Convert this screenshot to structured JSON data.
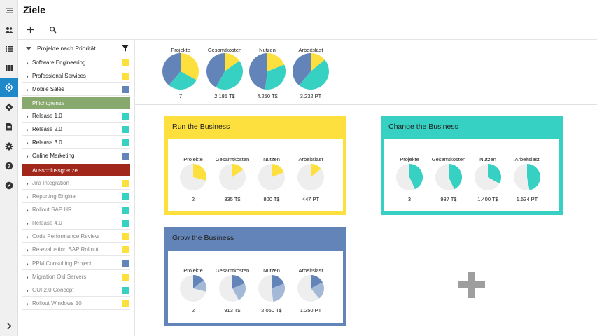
{
  "page": {
    "title": "Ziele"
  },
  "rail": {
    "items": [
      "menu",
      "people",
      "list",
      "board",
      "target",
      "diamond",
      "doc",
      "gear",
      "help",
      "compass"
    ],
    "active": "target"
  },
  "toolbar": {
    "add": "add",
    "search": "search"
  },
  "sidebar": {
    "header": "Projekte nach Priorität",
    "projects_a": [
      {
        "name": "Software Engineering",
        "color": "#fde03d"
      },
      {
        "name": "Professional Services",
        "color": "#fde03d"
      },
      {
        "name": "Mobile Sales",
        "color": "#6384b8"
      }
    ],
    "band_pflicht": {
      "label": "Pflichtgrenze",
      "color": "#88a96d"
    },
    "projects_b": [
      {
        "name": "Release 1.0",
        "color": "#36d1c3"
      },
      {
        "name": "Release 2.0",
        "color": "#36d1c3"
      },
      {
        "name": "Release 3.0",
        "color": "#36d1c3"
      },
      {
        "name": "Online Marketing",
        "color": "#6384b8"
      }
    ],
    "band_ausschluss": {
      "label": "Ausschlussgrenze",
      "color": "#a0271a"
    },
    "projects_c": [
      {
        "name": "Jira Integration",
        "color": "#fde03d"
      },
      {
        "name": "Reporting Engine",
        "color": "#36d1c3"
      },
      {
        "name": "Rollout SAP HR",
        "color": "#36d1c3"
      },
      {
        "name": "Release 4.0",
        "color": "#36d1c3"
      },
      {
        "name": "Code Performance Review",
        "color": "#fde03d"
      },
      {
        "name": "Re-evaluation SAP Rollout",
        "color": "#fde03d"
      },
      {
        "name": "PPM Consulting Project",
        "color": "#6384b8"
      },
      {
        "name": "Migration Old Servers",
        "color": "#fde03d"
      },
      {
        "name": "GUI 2.0 Concept",
        "color": "#36d1c3"
      },
      {
        "name": "Rollout Windows 10",
        "color": "#fde03d"
      }
    ]
  },
  "colors": {
    "yellow": "#fde03d",
    "teal": "#36d1c3",
    "blue": "#6384b8",
    "grey": "#eeeeee"
  },
  "summary": [
    {
      "label": "Projekte",
      "value": "7",
      "slices": [
        0.33,
        0.28,
        0.39
      ]
    },
    {
      "label": "Gesamtkosten",
      "value": "2.185 T$",
      "slices": [
        0.15,
        0.43,
        0.42
      ]
    },
    {
      "label": "Nutzen",
      "value": "4.250 T$",
      "slices": [
        0.19,
        0.33,
        0.48
      ]
    },
    {
      "label": "Arbeitslast",
      "value": "3.232 PT",
      "slices": [
        0.14,
        0.47,
        0.39
      ]
    }
  ],
  "goals": [
    {
      "title": "Run the Business",
      "color": "#fde03d",
      "metrics": [
        {
          "label": "Projekte",
          "value": "2",
          "share": 0.29
        },
        {
          "label": "Gesamtkosten",
          "value": "335 T$",
          "share": 0.15
        },
        {
          "label": "Nutzen",
          "value": "800 T$",
          "share": 0.19
        },
        {
          "label": "Arbeitslast",
          "value": "447 PT",
          "share": 0.14
        }
      ]
    },
    {
      "title": "Change the Business",
      "color": "#36d1c3",
      "metrics": [
        {
          "label": "Projekte",
          "value": "3",
          "share": 0.43
        },
        {
          "label": "Gesamtkosten",
          "value": "937 T$",
          "share": 0.43
        },
        {
          "label": "Nutzen",
          "value": "1.400 T$",
          "share": 0.33
        },
        {
          "label": "Arbeitslast",
          "value": "1.534 PT",
          "share": 0.47
        }
      ]
    },
    {
      "title": "Grow the Business",
      "color": "#6384b8",
      "metrics": [
        {
          "label": "Projekte",
          "value": "2",
          "share": 0.29,
          "sub": 0.5
        },
        {
          "label": "Gesamtkosten",
          "value": "913 T$",
          "share": 0.42,
          "sub": 0.45
        },
        {
          "label": "Nutzen",
          "value": "2.050 T$",
          "share": 0.48,
          "sub": 0.4
        },
        {
          "label": "Arbeitslast",
          "value": "1.250 PT",
          "share": 0.39,
          "sub": 0.45
        }
      ]
    }
  ]
}
